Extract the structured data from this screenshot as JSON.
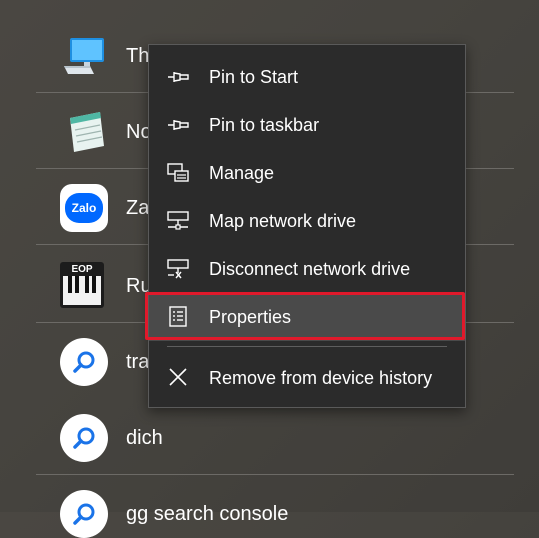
{
  "list": {
    "items": [
      {
        "label": "Th",
        "icon": "computer-icon"
      },
      {
        "label": "No",
        "icon": "notepad-icon"
      },
      {
        "label": "Za",
        "icon": "zalo-icon",
        "icon_text": "Zalo"
      },
      {
        "label": "Ru",
        "icon": "piano-icon",
        "icon_text": "EOP"
      },
      {
        "label": "tra",
        "icon": "search-icon"
      },
      {
        "label": "dich",
        "icon": "search-icon"
      },
      {
        "label": "gg search console",
        "icon": "search-icon"
      }
    ]
  },
  "context_menu": {
    "items": [
      {
        "label": "Pin to Start",
        "icon": "pin-icon"
      },
      {
        "label": "Pin to taskbar",
        "icon": "pin-icon"
      },
      {
        "label": "Manage",
        "icon": "manage-icon"
      },
      {
        "label": "Map network drive",
        "icon": "network-drive-icon"
      },
      {
        "label": "Disconnect network drive",
        "icon": "disconnect-drive-icon"
      },
      {
        "label": "Properties",
        "icon": "properties-icon"
      },
      {
        "label": "Remove from device history",
        "icon": "close-icon"
      }
    ],
    "highlighted": "Properties",
    "highlight_color": "#e0192b"
  },
  "colors": {
    "background": "#46443f",
    "menu_background": "#2b2b2b",
    "zalo_blue": "#0068ff",
    "search_blue": "#1a73e8"
  }
}
